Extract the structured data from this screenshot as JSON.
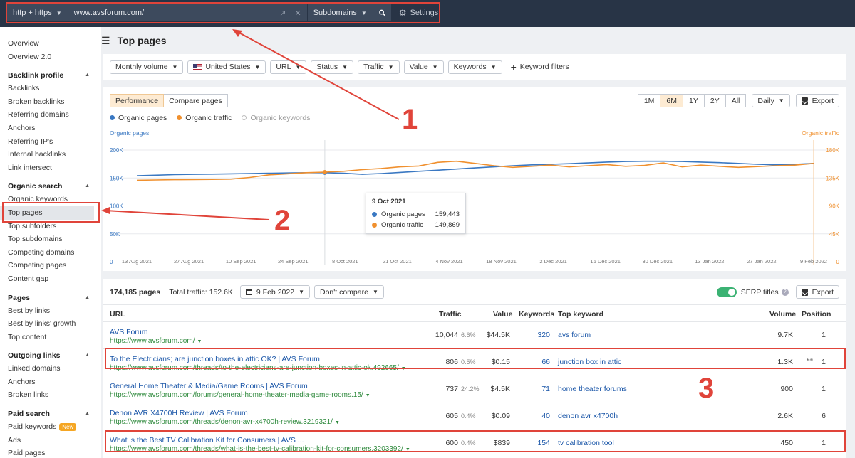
{
  "topbar": {
    "protocol": "http + https",
    "url": "www.avsforum.com/",
    "mode": "Subdomains",
    "settings": "Settings"
  },
  "sidebar": {
    "top": [
      "Overview",
      "Overview 2.0"
    ],
    "sections": [
      {
        "title": "Backlink profile",
        "items": [
          "Backlinks",
          "Broken backlinks",
          "Referring domains",
          "Anchors",
          "Referring IP's",
          "Internal backlinks",
          "Link intersect"
        ]
      },
      {
        "title": "Organic search",
        "items": [
          "Organic keywords",
          "Top pages",
          "Top subfolders",
          "Top subdomains",
          "Competing domains",
          "Competing pages",
          "Content gap"
        ]
      },
      {
        "title": "Pages",
        "items": [
          "Best by links",
          "Best by links' growth",
          "Top content"
        ]
      },
      {
        "title": "Outgoing links",
        "items": [
          "Linked domains",
          "Anchors",
          "Broken links"
        ]
      },
      {
        "title": "Paid search",
        "items": [
          "Paid keywords",
          "Ads",
          "Paid pages"
        ]
      }
    ],
    "new_badge": "New"
  },
  "page": {
    "title": "Top pages"
  },
  "filters": [
    "Monthly volume",
    "United States",
    "URL",
    "Status",
    "Traffic",
    "Value",
    "Keywords"
  ],
  "keyword_filters": "Keyword filters",
  "chart_panel": {
    "tabs": [
      "Performance",
      "Compare pages"
    ],
    "ranges": [
      "1M",
      "6M",
      "1Y",
      "2Y",
      "All"
    ],
    "interval": "Daily",
    "export": "Export",
    "legend": [
      "Organic pages",
      "Organic traffic",
      "Organic keywords"
    ],
    "tooltip": {
      "date": "9 Oct 2021",
      "rows": [
        {
          "label": "Organic pages",
          "value": "159,443"
        },
        {
          "label": "Organic traffic",
          "value": "149,869"
        }
      ]
    }
  },
  "chart_data": {
    "type": "line",
    "left_axis_label": "Organic pages",
    "right_axis_label": "Organic traffic",
    "left_ticks": [
      "200K",
      "150K",
      "100K",
      "50K",
      "0"
    ],
    "right_ticks": [
      "180K",
      "135K",
      "90K",
      "45K",
      "0"
    ],
    "left_ylim": [
      0,
      200000
    ],
    "right_ylim": [
      0,
      180000
    ],
    "x_ticks": [
      "13 Aug 2021",
      "27 Aug 2021",
      "10 Sep 2021",
      "24 Sep 2021",
      "8 Oct 2021",
      "21 Oct 2021",
      "4 Nov 2021",
      "18 Nov 2021",
      "2 Dec 2021",
      "16 Dec 2021",
      "30 Dec 2021",
      "13 Jan 2022",
      "27 Jan 2022",
      "9 Feb 2022"
    ],
    "series": [
      {
        "name": "Organic pages",
        "color": "#3a78c2",
        "axis": "left",
        "values": [
          154000,
          155000,
          156000,
          156500,
          157000,
          157500,
          158000,
          158500,
          159000,
          159500,
          159443,
          158500,
          156500,
          158000,
          160000,
          162000,
          164000,
          166000,
          168000,
          170000,
          172000,
          173500,
          174500,
          175500,
          177000,
          178500,
          179500,
          180000,
          180000,
          179500,
          178500,
          177500,
          176000,
          174500,
          173500,
          174500,
          176000
        ]
      },
      {
        "name": "Organic traffic",
        "color": "#f0902e",
        "axis": "left",
        "values": [
          146000,
          146500,
          147000,
          147200,
          147500,
          148000,
          151000,
          155500,
          157500,
          159500,
          160500,
          162000,
          165000,
          167000,
          170000,
          171500,
          178000,
          180000,
          176000,
          172000,
          169000,
          171000,
          173000,
          170000,
          172000,
          174000,
          171000,
          172500,
          177000,
          170000,
          173000,
          171000,
          169000,
          170500,
          172000,
          173000,
          176000
        ]
      }
    ]
  },
  "table_panel": {
    "count": "174,185 pages",
    "total": "Total traffic: 152.6K",
    "date": "9 Feb 2022",
    "compare": "Don't compare",
    "serp_titles": "SERP titles",
    "export": "Export",
    "columns": {
      "url": "URL",
      "traffic": "Traffic",
      "value": "Value",
      "keywords": "Keywords",
      "top_keyword": "Top keyword",
      "volume": "Volume",
      "position": "Position"
    },
    "rows": [
      {
        "title": "AVS Forum",
        "url": "https://www.avsforum.com/",
        "traffic": "10,044",
        "pct": "6.6%",
        "value": "$44.5K",
        "keywords": "320",
        "top_keyword": "avs forum",
        "volume": "9.7K",
        "position": "1"
      },
      {
        "title": "To the Electricians; are junction boxes in attic OK? | AVS Forum",
        "url": "https://www.avsforum.com/threads/to-the-electricians-are-junction-boxes-in-attic-ok.492665/",
        "traffic": "806",
        "pct": "0.5%",
        "value": "$0.15",
        "keywords": "66",
        "top_keyword": "junction box in attic",
        "volume": "1.3K",
        "position": "1"
      },
      {
        "title": "General Home Theater & Media/Game Rooms | AVS Forum",
        "url": "https://www.avsforum.com/forums/general-home-theater-media-game-rooms.15/",
        "traffic": "737",
        "pct": "24.2%",
        "value": "$4.5K",
        "keywords": "71",
        "top_keyword": "home theater forums",
        "volume": "900",
        "position": "1"
      },
      {
        "title": "Denon AVR X4700H Review | AVS Forum",
        "url": "https://www.avsforum.com/threads/denon-avr-x4700h-review.3219321/",
        "traffic": "605",
        "pct": "0.4%",
        "value": "$0.09",
        "keywords": "40",
        "top_keyword": "denon avr x4700h",
        "volume": "2.6K",
        "position": "6"
      },
      {
        "title": "What is the Best TV Calibration Kit for Consumers | AVS ...",
        "url": "https://www.avsforum.com/threads/what-is-the-best-tv-calibration-kit-for-consumers.3203392/",
        "traffic": "600",
        "pct": "0.4%",
        "value": "$839",
        "keywords": "154",
        "top_keyword": "tv calibration tool",
        "volume": "450",
        "position": "1"
      }
    ]
  },
  "annotations": [
    "1",
    "2",
    "3"
  ]
}
